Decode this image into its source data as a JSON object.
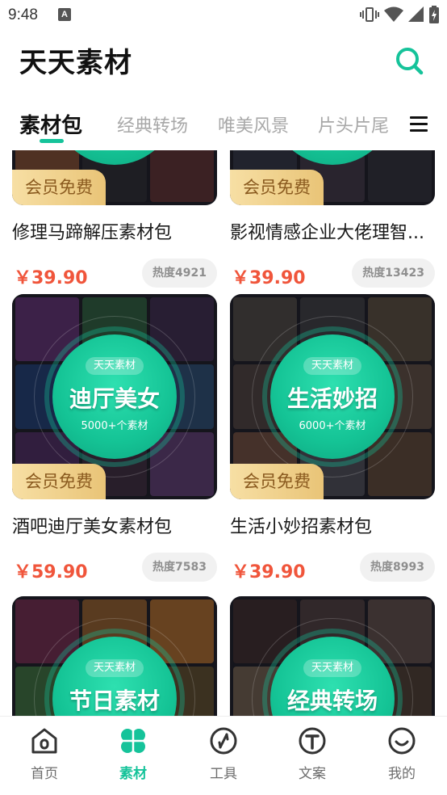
{
  "status_bar": {
    "time": "9:48",
    "notification_icon": "A"
  },
  "header": {
    "title": "天天素材",
    "search_icon": "search-icon"
  },
  "tabs": [
    {
      "label": "素材包",
      "active": true
    },
    {
      "label": "经典转场",
      "active": false
    },
    {
      "label": "唯美风景",
      "active": false
    },
    {
      "label": "片头片尾",
      "active": false
    }
  ],
  "colors": {
    "accent": "#15c39a",
    "price": "#f0553b",
    "vip_bg": "#e9c477",
    "vip_text": "#8a5a1f"
  },
  "cards": [
    {
      "circle_tag": "",
      "circle_title": "",
      "circle_sub": "",
      "vip": "会员免费",
      "title": "修理马蹄解压素材包",
      "price": "￥39.90",
      "heat": "热度4921"
    },
    {
      "circle_tag": "",
      "circle_title": "",
      "circle_sub": "",
      "vip": "会员免费",
      "title": "影视情感企业大佬理智...",
      "price": "￥39.90",
      "heat": "热度13423"
    },
    {
      "circle_tag": "天天素材",
      "circle_title": "迪厅美女",
      "circle_sub": "5000+个素材",
      "vip": "会员免费",
      "title": "酒吧迪厅美女素材包",
      "price": "￥59.90",
      "heat": "热度7583"
    },
    {
      "circle_tag": "天天素材",
      "circle_title": "生活妙招",
      "circle_sub": "6000+个素材",
      "vip": "会员免费",
      "title": "生活小妙招素材包",
      "price": "￥39.90",
      "heat": "热度8993"
    },
    {
      "circle_tag": "天天素材",
      "circle_title": "节日素材",
      "circle_sub": "",
      "vip": "",
      "title": "",
      "price": "",
      "heat": ""
    },
    {
      "circle_tag": "天天素材",
      "circle_title": "经典转场",
      "circle_sub": "",
      "vip": "",
      "title": "",
      "price": "",
      "heat": ""
    }
  ],
  "bottom_nav": [
    {
      "label": "首页",
      "icon": "home-icon",
      "active": false
    },
    {
      "label": "素材",
      "icon": "clover-icon",
      "active": true
    },
    {
      "label": "工具",
      "icon": "compass-icon",
      "active": false
    },
    {
      "label": "文案",
      "icon": "text-icon",
      "active": false
    },
    {
      "label": "我的",
      "icon": "smile-icon",
      "active": false
    }
  ]
}
